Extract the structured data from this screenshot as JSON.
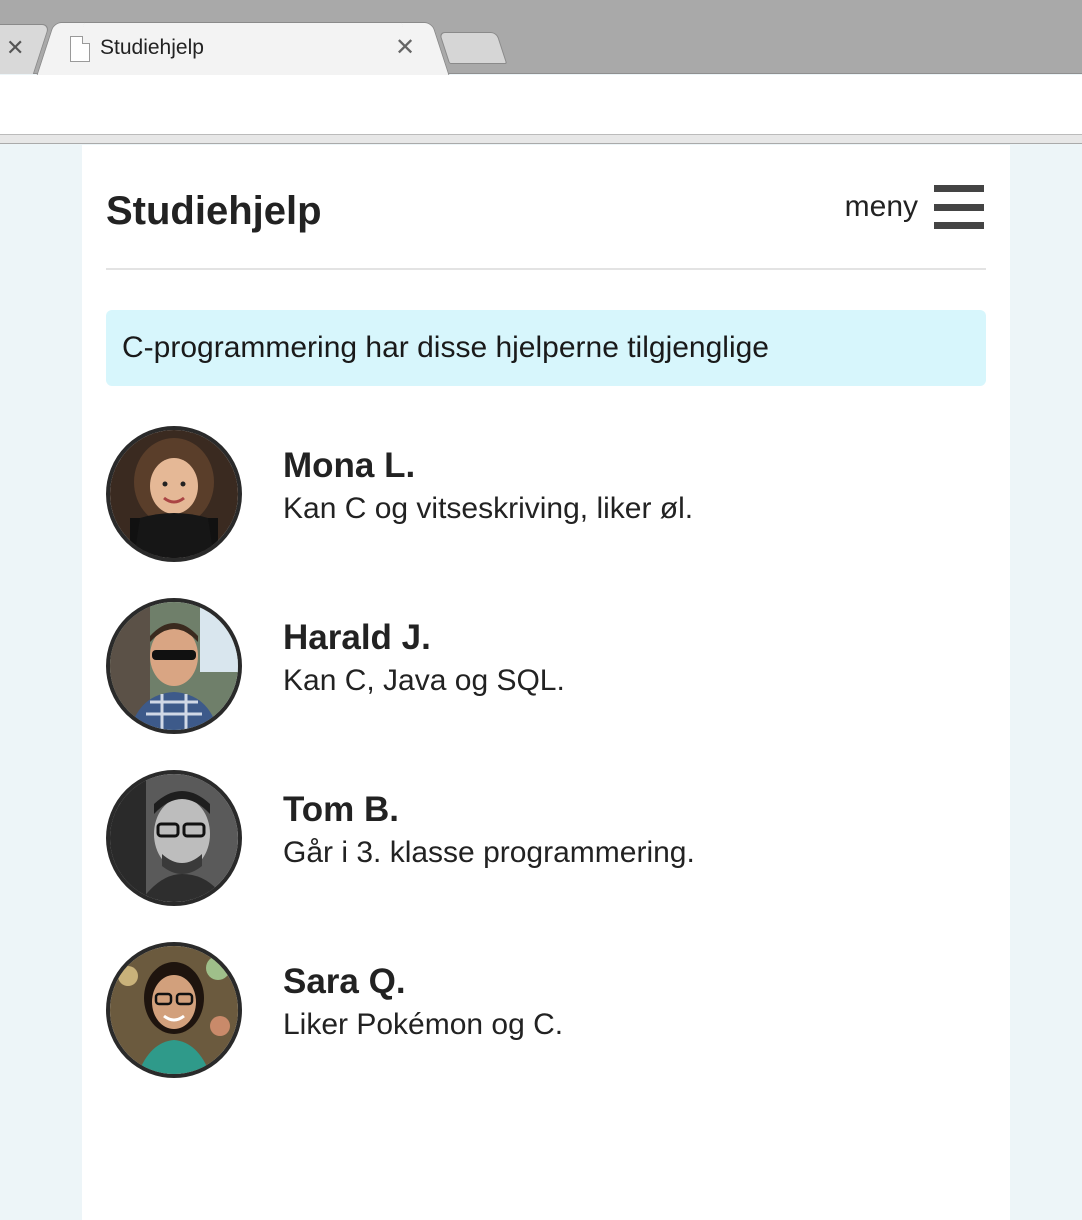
{
  "browser": {
    "prev_tab_close": "✕",
    "active_tab": {
      "title": "Studiehjelp",
      "close": "✕"
    }
  },
  "header": {
    "title": "Studiehjelp",
    "menu_label": "meny"
  },
  "info": {
    "text": "C-programmering har disse hjelperne tilgjenglige"
  },
  "helpers": [
    {
      "name": "Mona L.",
      "description": "Kan C og vitseskriving, liker øl."
    },
    {
      "name": "Harald J.",
      "description": "Kan C, Java og SQL."
    },
    {
      "name": "Tom B.",
      "description": "Går i 3. klasse programmering."
    },
    {
      "name": "Sara Q.",
      "description": "Liker Pokémon og C."
    }
  ],
  "colors": {
    "info_background": "#d7f6fc",
    "page_background": "#edf5f8",
    "hamburger": "#444444"
  }
}
